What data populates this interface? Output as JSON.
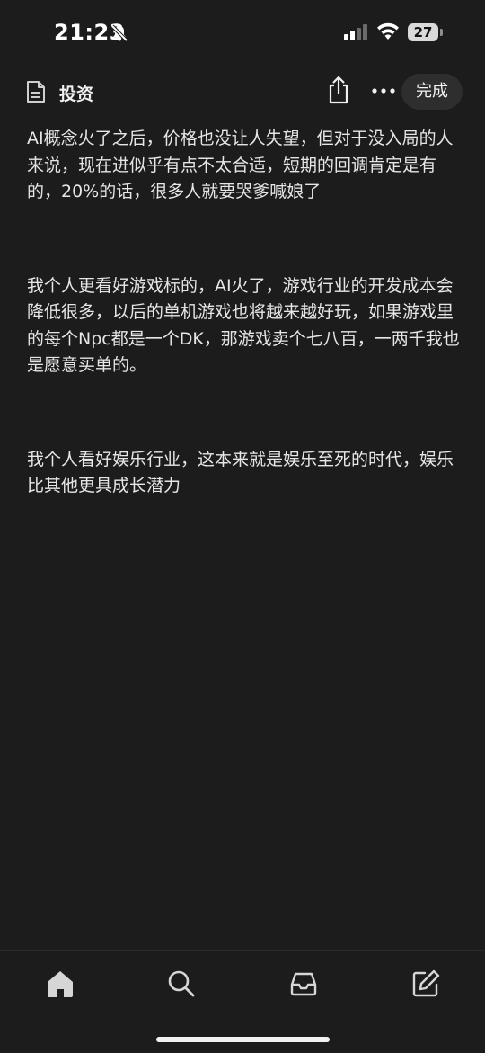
{
  "status_bar": {
    "time": "21:23",
    "battery": "27"
  },
  "header": {
    "title": "投资",
    "done_label": "完成"
  },
  "note": {
    "paragraphs": [
      "AI概念火了之后，价格也没让人失望，但对于没入局的人来说，现在进似乎有点不太合适，短期的回调肯定是有的，20%的话，很多人就要哭爹喊娘了",
      "我个人更看好游戏标的，AI火了，游戏行业的开发成本会降低很多，以后的单机游戏也将越来越好玩，如果游戏里的每个Npc都是一个DK，那游戏卖个七八百，一两千我也是愿意买单的。",
      "我个人看好娱乐行业，这本来就是娱乐至死的时代，娱乐比其他更具成长潜力"
    ]
  },
  "tab_bar": {
    "items": [
      "home-icon",
      "search-icon",
      "inbox-icon",
      "compose-icon"
    ]
  },
  "colors": {
    "background": "#1c1c1c",
    "text": "#e6e6e6",
    "done_button_bg": "#2e2e2e"
  }
}
